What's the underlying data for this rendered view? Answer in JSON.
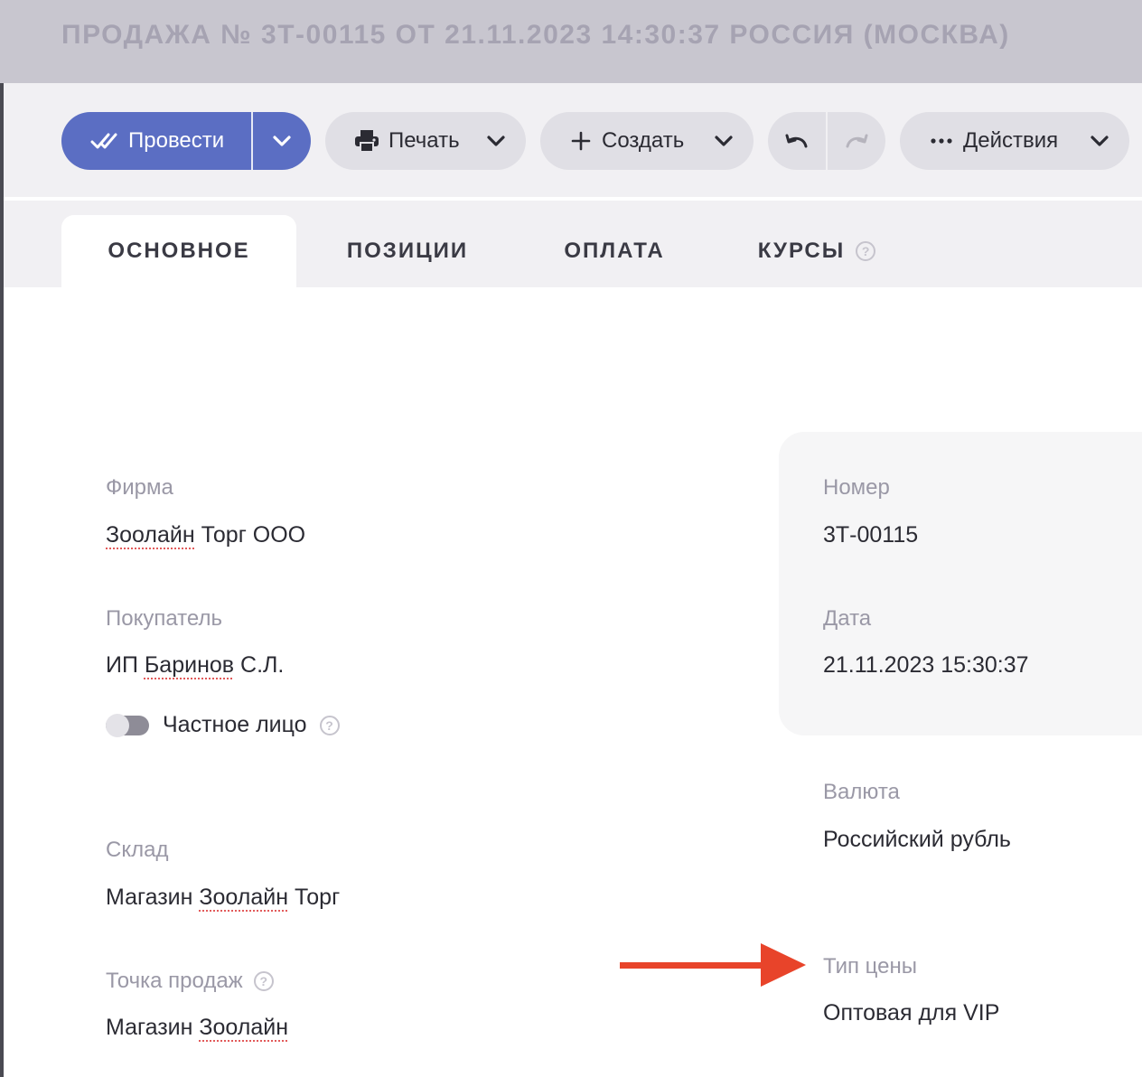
{
  "window": {
    "title": "ПРОДАЖА № 3Т-00115 ОТ 21.11.2023 14:30:37 РОССИЯ (МОСКВА)"
  },
  "toolbar": {
    "post_label": "Провести",
    "print_label": "Печать",
    "create_label": "Создать",
    "actions_label": "Действия"
  },
  "tabs": [
    {
      "label": "ОСНОВНОЕ",
      "active": true
    },
    {
      "label": "ПОЗИЦИИ",
      "active": false
    },
    {
      "label": "ОПЛАТА",
      "active": false
    },
    {
      "label": "КУРСЫ",
      "active": false
    }
  ],
  "help_glyph": "?",
  "form": {
    "firm": {
      "label": "Фирма",
      "value_part1": "Зоолайн",
      "value_part2": " Торг ООО"
    },
    "buyer": {
      "label": "Покупатель",
      "value_part1": "ИП ",
      "value_part2": "Баринов",
      "value_part3": " С.Л."
    },
    "private_person": {
      "label": "Частное лицо",
      "checked": false
    },
    "warehouse": {
      "label": "Склад",
      "value_part1": "Магазин ",
      "value_part2": "Зоолайн",
      "value_part3": " Торг"
    },
    "point_of_sale": {
      "label": "Точка продаж",
      "value_part1": "Магазин ",
      "value_part2": "Зоолайн"
    },
    "number": {
      "label": "Номер",
      "value": "3Т-00115"
    },
    "date": {
      "label": "Дата",
      "value": "21.11.2023 15:30:37"
    },
    "currency": {
      "label": "Валюта",
      "value": "Российский рубль"
    },
    "price_type": {
      "label": "Тип цены",
      "value": "Оптовая для VIP"
    }
  },
  "colors": {
    "primary": "#5b6ec3",
    "annotation_arrow": "#e8442a",
    "spell_underline": "#e25a5a"
  },
  "icons": {
    "post": "double-check-icon",
    "print": "printer-icon",
    "create": "plus-icon",
    "undo": "undo-icon",
    "redo": "redo-icon",
    "actions": "more-dots-icon",
    "dropdown": "chevron-down-icon",
    "help": "help-circle-icon"
  }
}
